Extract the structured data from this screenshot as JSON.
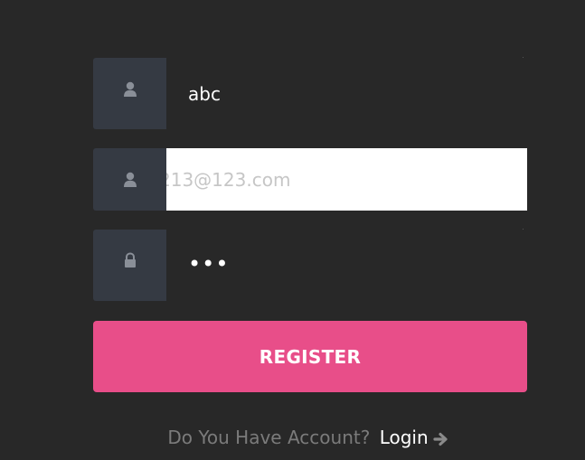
{
  "form": {
    "username": {
      "icon": "user-icon",
      "value": "abc"
    },
    "email": {
      "icon": "user-icon",
      "placeholder": "213@123.com"
    },
    "password": {
      "icon": "lock-icon",
      "masked_value": "•••"
    },
    "register_label": "REGISTER"
  },
  "footer": {
    "question": "Do You Have Account?",
    "login_label": "Login",
    "login_icon": "arrow-right-icon"
  },
  "colors": {
    "background": "#282828",
    "icon_cell": "#353a43",
    "icon": "#8a8f98",
    "accent": "#e84e89",
    "muted_text": "#7b7b7b"
  }
}
